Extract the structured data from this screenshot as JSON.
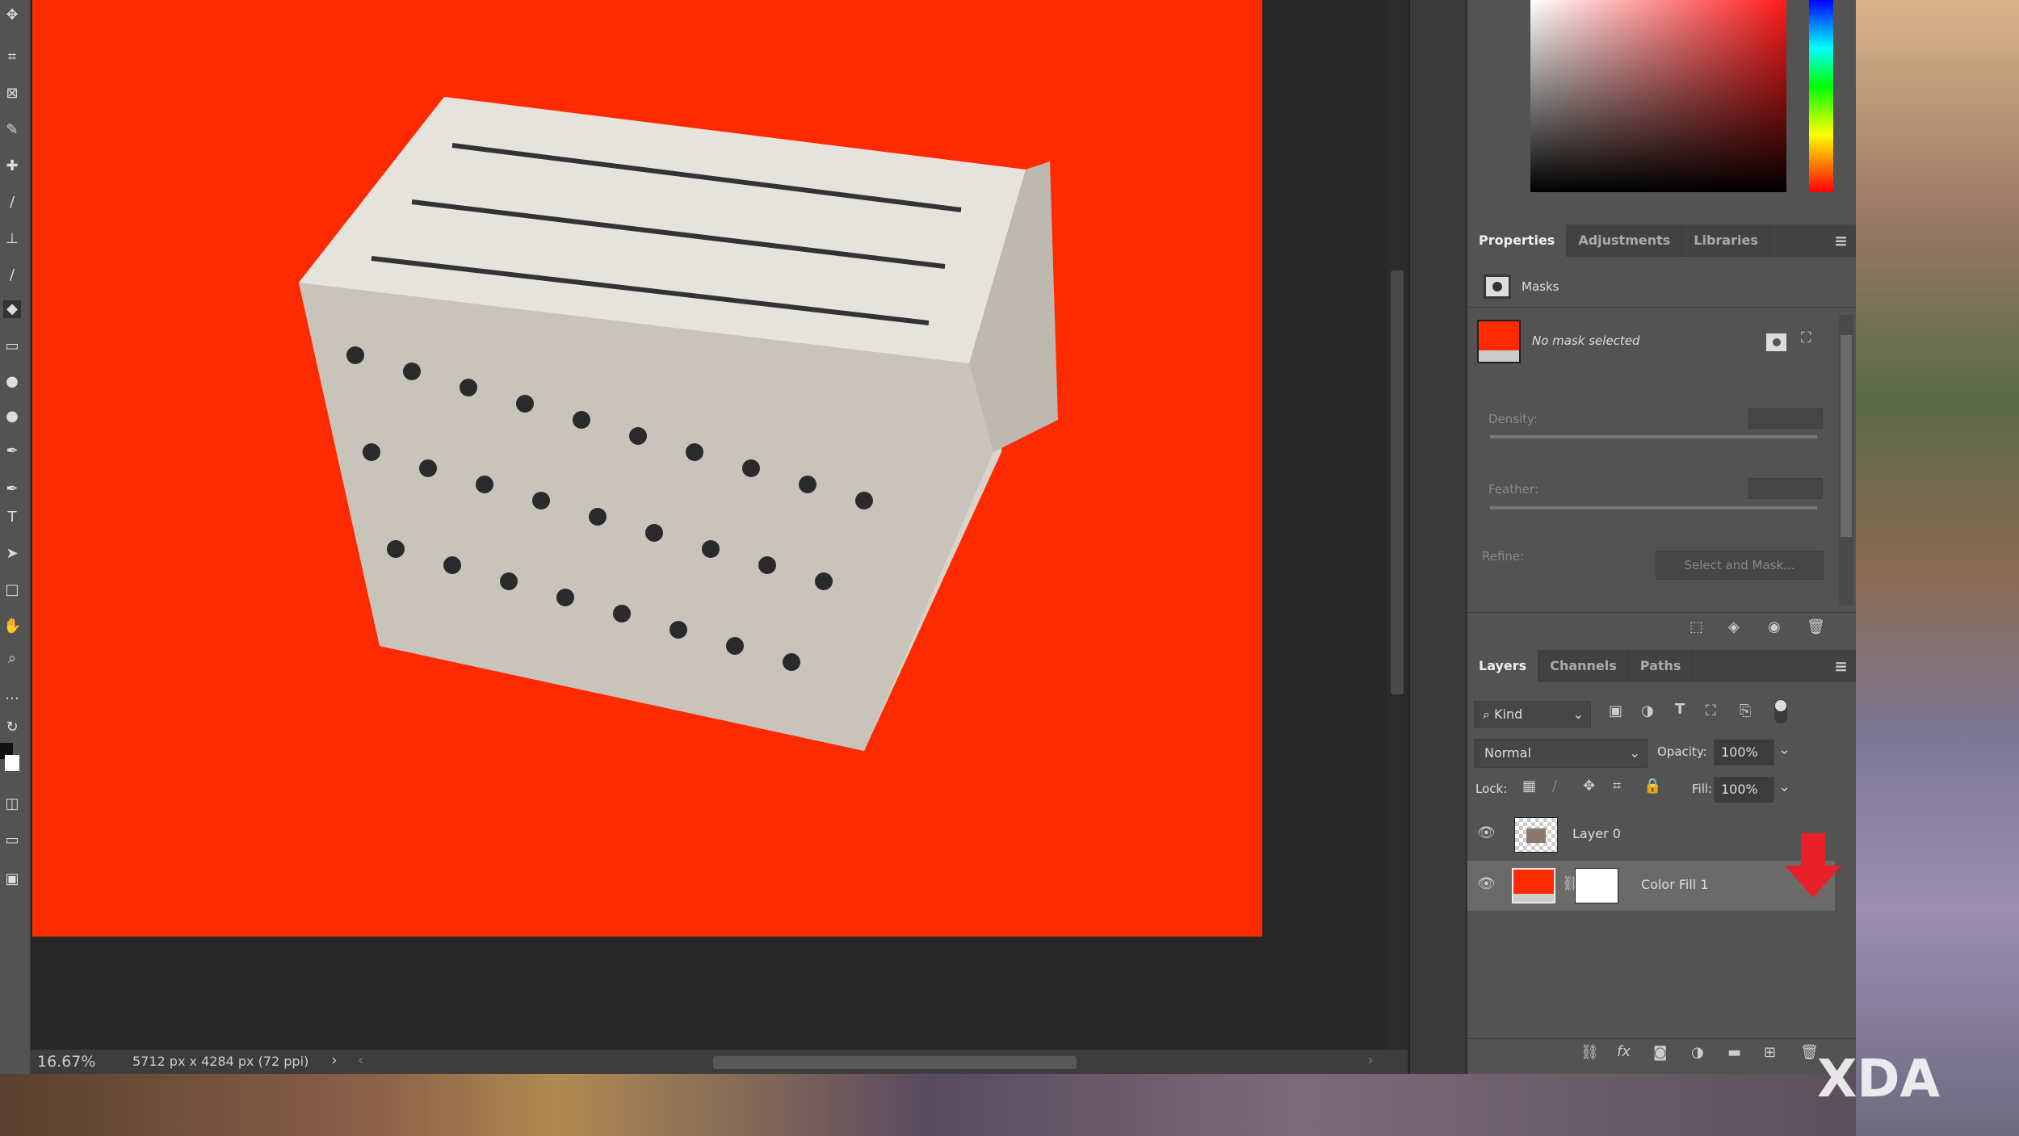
{
  "status": {
    "zoom": "16.67%",
    "doc_info": "5712 px x 4284 px (72 ppi)"
  },
  "properties": {
    "tabs": [
      "Properties",
      "Adjustments",
      "Libraries"
    ],
    "section": "Masks",
    "mask_status": "No mask selected",
    "density_label": "Density:",
    "feather_label": "Feather:",
    "refine_label": "Refine:",
    "select_and_mask": "Select and Mask..."
  },
  "layers": {
    "tabs": [
      "Layers",
      "Channels",
      "Paths"
    ],
    "filter_kind": "Kind",
    "blend_mode": "Normal",
    "opacity_label": "Opacity:",
    "opacity": "100%",
    "lock_label": "Lock:",
    "fill_label": "Fill:",
    "fill": "100%",
    "items": [
      {
        "name": "Layer 0",
        "visible": true
      },
      {
        "name": "Color Fill 1",
        "visible": true,
        "selected": true
      }
    ]
  },
  "colors": {
    "fill": "#ff2a00",
    "annotation_arrow": "#e8202a"
  },
  "watermark": "XDA"
}
